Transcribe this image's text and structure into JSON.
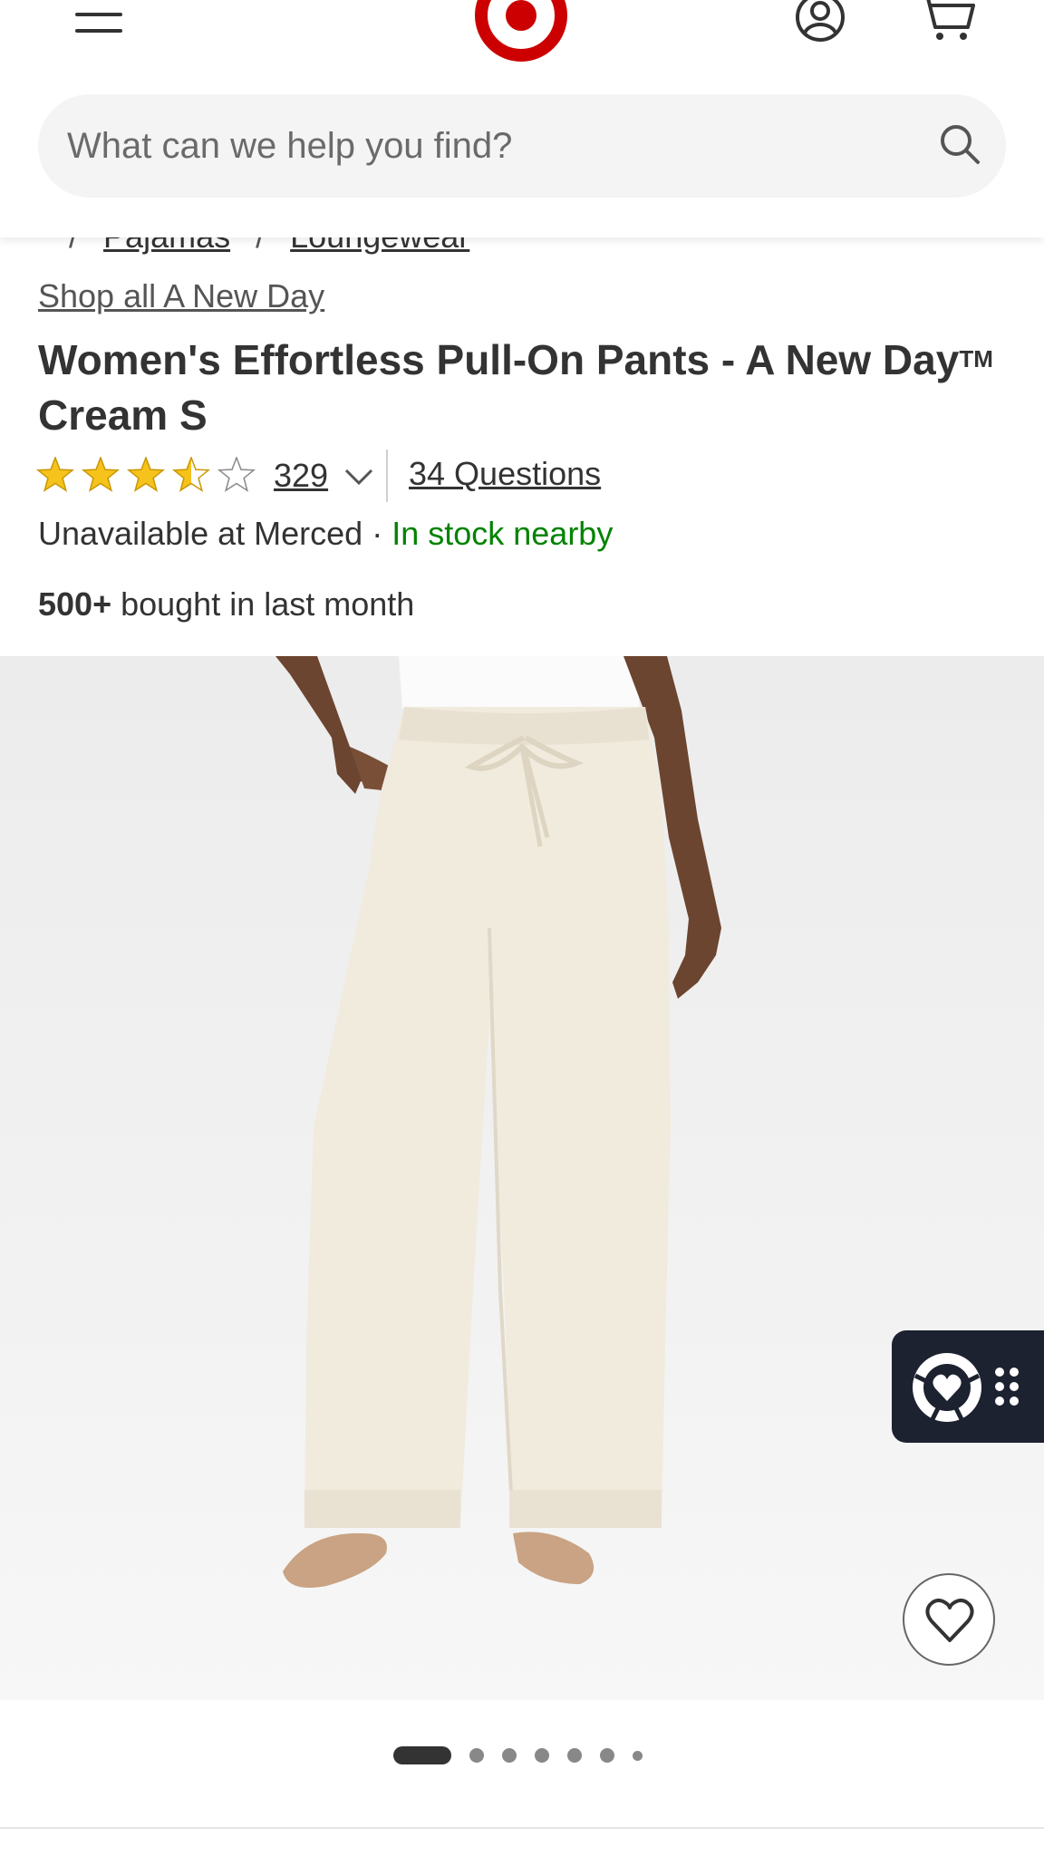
{
  "header": {
    "search_placeholder": "What can we help you find?"
  },
  "breadcrumb": {
    "items": [
      "Pajamas",
      "Loungewear"
    ]
  },
  "product": {
    "brand_link": "Shop all A New Day",
    "title_part1": "Women's Effortless Pull-On Pants - A New Day",
    "title_tm": "TM",
    "title_part2": " Cream S",
    "rating": 3.5,
    "rating_max": 5,
    "review_count": "329",
    "questions": "34 Questions",
    "availability_store": "Unavailable at Merced",
    "availability_separator": " · ",
    "availability_nearby": "In stock nearby",
    "bought_count": "500+",
    "bought_text": " bought in last month"
  },
  "carousel": {
    "total_images": 7,
    "active_index": 0
  },
  "colors": {
    "brand_red": "#cc0000",
    "in_stock_green": "#008300",
    "star_gold": "#f6c21c",
    "widget_bg": "#1d2230"
  }
}
